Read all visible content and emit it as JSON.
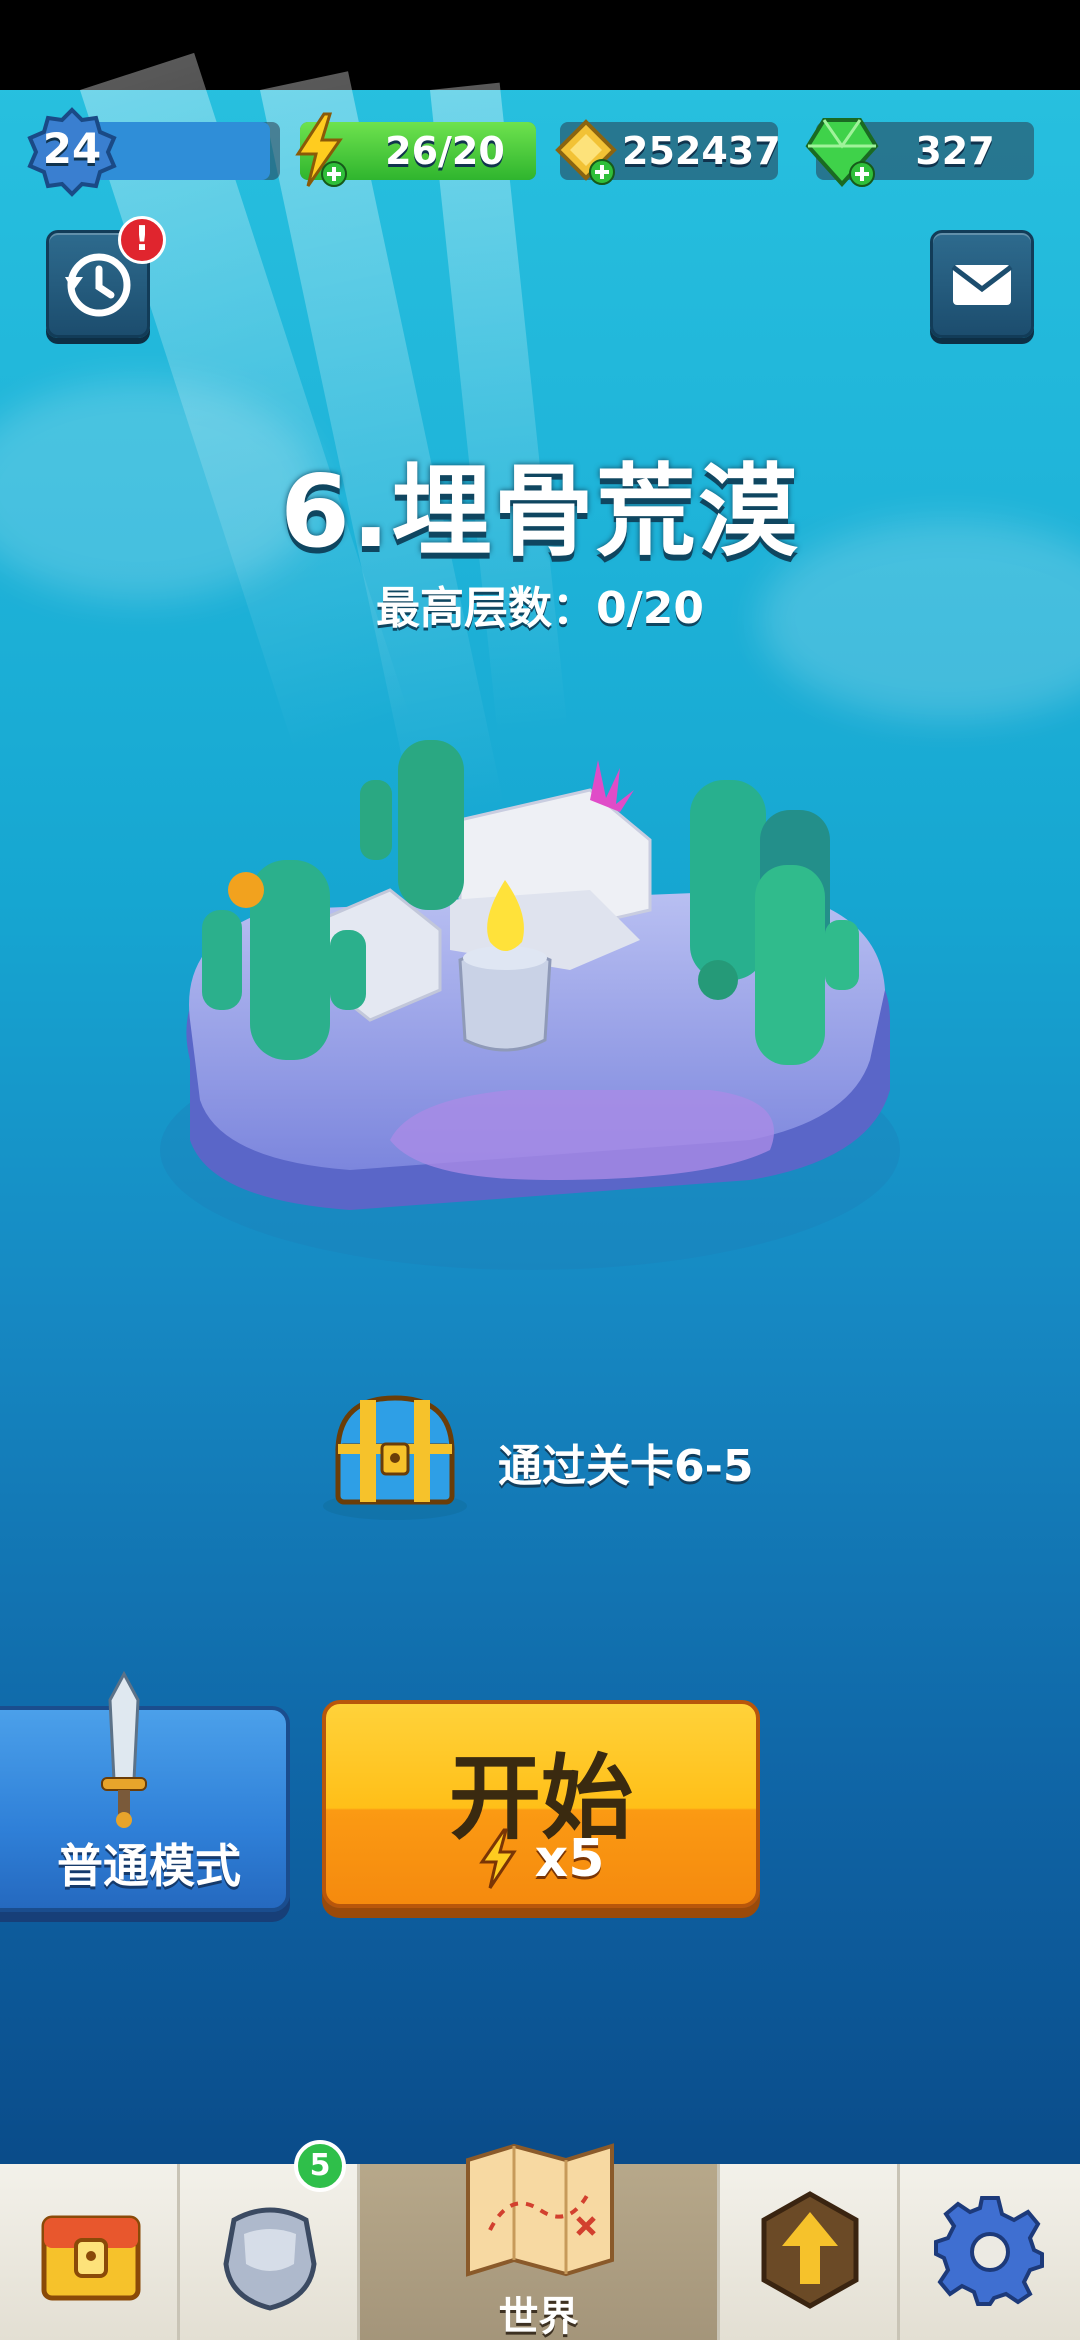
{
  "header": {
    "level": "24",
    "level_progress": 0.95,
    "energy": "26/20",
    "gold": "252437",
    "gems": "327"
  },
  "stage": {
    "title": "6.埋骨荒漠",
    "best_floor": "最高层数：0/20"
  },
  "reward": {
    "condition": "通过关卡6-5",
    "icon": "treasure-chest"
  },
  "actions": {
    "mode_label": "普通模式",
    "start_label": "开始",
    "start_cost": "x5"
  },
  "nav": {
    "items": [
      {
        "name": "chest",
        "icon": "locked-chest-icon",
        "label": ""
      },
      {
        "name": "equipment",
        "icon": "armor-icon",
        "label": "",
        "badge": "5"
      },
      {
        "name": "world",
        "icon": "map-icon",
        "label": "世界",
        "active": true
      },
      {
        "name": "upgrade",
        "icon": "upgrade-arrow-icon",
        "label": ""
      },
      {
        "name": "settings",
        "icon": "gear-icon",
        "label": ""
      }
    ]
  },
  "alerts": {
    "history_alert": "!"
  },
  "colors": {
    "energy_green": "#39c93a",
    "level_blue": "#2f8ed8",
    "start_orange": "#ffbf18",
    "mode_blue": "#3a8fe0"
  }
}
